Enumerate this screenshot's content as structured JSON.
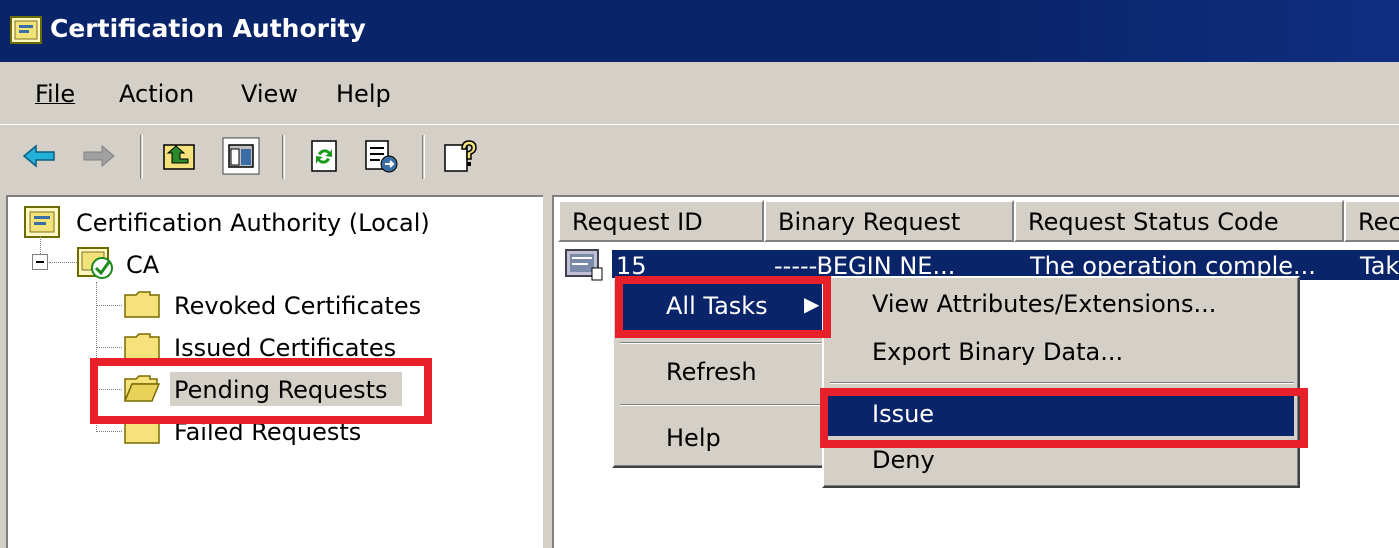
{
  "window": {
    "title": "Certification Authority",
    "icon": "certificate-snapin-icon"
  },
  "menubar": {
    "file": "File",
    "action": "Action",
    "view": "View",
    "help": "Help"
  },
  "toolbar": {
    "icons": [
      "back-arrow-icon",
      "forward-arrow-icon",
      "up-folder-icon",
      "show-hide-tree-icon",
      "refresh-icon",
      "export-list-icon",
      "help-icon"
    ]
  },
  "tree": {
    "root": "Certification Authority (Local)",
    "ca": "CA",
    "items": [
      {
        "label": "Revoked Certificates"
      },
      {
        "label": "Issued Certificates"
      },
      {
        "label": "Pending Requests"
      },
      {
        "label": "Failed Requests"
      }
    ]
  },
  "list": {
    "columns": [
      "Request ID",
      "Binary Request",
      "Request Status Code",
      "Rec"
    ],
    "rows": [
      {
        "request_id": "15",
        "binary_request": "-----BEGIN NE...",
        "status_code": "The operation comple...",
        "col4": "Tak"
      }
    ]
  },
  "context_menu": {
    "all_tasks": "All Tasks",
    "refresh": "Refresh",
    "help": "Help"
  },
  "submenu": {
    "view_attributes": "View Attributes/Extensions...",
    "export_binary": "Export Binary Data...",
    "issue": "Issue",
    "deny": "Deny"
  },
  "colors": {
    "titlebar": "#0a246a",
    "selection": "#0a246a",
    "chrome": "#d4d0c8",
    "highlight_box": "#e8202a"
  }
}
